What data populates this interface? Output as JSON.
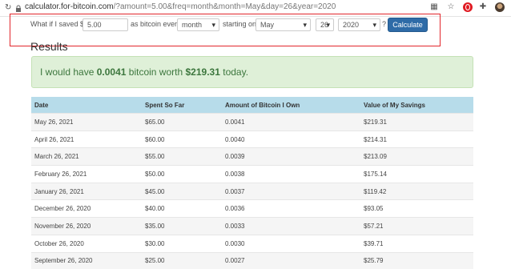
{
  "browser": {
    "url_host": "calculator.for-bitcoin.com",
    "url_path": "/?amount=5.00&freq=month&month=May&day=26&year=2020"
  },
  "form": {
    "label_saved": "What if I saved $",
    "amount_value": "5.00",
    "label_every": "as bitcoin every",
    "freq_value": "month",
    "label_starting": "starting on",
    "month_value": "May",
    "day_value": "26",
    "year_value": "2020",
    "question_mark": "?",
    "calculate_label": "Calculate"
  },
  "results": {
    "title": "Results",
    "sentence_prefix": "I would have",
    "bitcoin_amount": "0.0041",
    "sentence_middle": "bitcoin worth",
    "worth_value": "$219.31",
    "sentence_suffix": "today."
  },
  "table": {
    "headers": [
      "Date",
      "Spent So Far",
      "Amount of Bitcoin I Own",
      "Value of My Savings"
    ],
    "rows": [
      [
        "May 26, 2021",
        "$65.00",
        "0.0041",
        "$219.31"
      ],
      [
        "April 26, 2021",
        "$60.00",
        "0.0040",
        "$214.31"
      ],
      [
        "March 26, 2021",
        "$55.00",
        "0.0039",
        "$213.09"
      ],
      [
        "February 26, 2021",
        "$50.00",
        "0.0038",
        "$175.14"
      ],
      [
        "January 26, 2021",
        "$45.00",
        "0.0037",
        "$119.42"
      ],
      [
        "December 26, 2020",
        "$40.00",
        "0.0036",
        "$93.05"
      ],
      [
        "November 26, 2020",
        "$35.00",
        "0.0033",
        "$57.21"
      ],
      [
        "October 26, 2020",
        "$30.00",
        "0.0030",
        "$39.71"
      ],
      [
        "September 26, 2020",
        "$25.00",
        "0.0027",
        "$25.79"
      ]
    ]
  },
  "colors": {
    "highlight_box": "#e2262b",
    "button": "#2e6ba7",
    "table_header": "#b7dcea",
    "alert_bg": "#dff0d8",
    "alert_text": "#3c763d"
  }
}
